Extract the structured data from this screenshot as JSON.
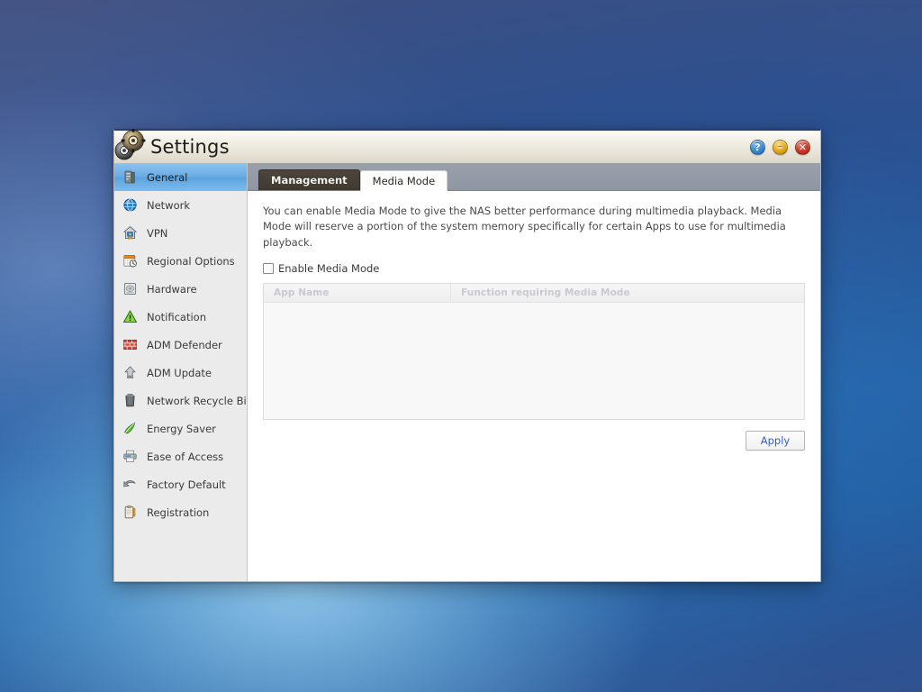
{
  "window": {
    "title": "Settings",
    "app_icon": "gear-icon",
    "buttons": [
      {
        "name": "help-button",
        "icon": "question-mark-icon",
        "glyph": "?",
        "color": "#3e8fd4"
      },
      {
        "name": "minimize-button",
        "icon": "minus-icon",
        "glyph": "–",
        "color": "#e8ad21"
      },
      {
        "name": "close-button",
        "icon": "close-x-icon",
        "glyph": "✕",
        "color": "#d23c2c"
      }
    ]
  },
  "sidebar": {
    "items": [
      {
        "label": "General",
        "icon": "server-icon",
        "selected": true
      },
      {
        "label": "Network",
        "icon": "globe-icon",
        "selected": false
      },
      {
        "label": "VPN",
        "icon": "house-lock-icon",
        "selected": false
      },
      {
        "label": "Regional Options",
        "icon": "calendar-clock-icon",
        "selected": false
      },
      {
        "label": "Hardware",
        "icon": "hard-drive-icon",
        "selected": false
      },
      {
        "label": "Notification",
        "icon": "warning-triangle-icon",
        "selected": false
      },
      {
        "label": "ADM Defender",
        "icon": "firewall-brick-icon",
        "selected": false
      },
      {
        "label": "ADM Update",
        "icon": "up-arrow-icon",
        "selected": false
      },
      {
        "label": "Network Recycle Bin",
        "icon": "trash-bin-icon",
        "selected": false
      },
      {
        "label": "Energy Saver",
        "icon": "green-leaf-icon",
        "selected": false
      },
      {
        "label": "Ease of Access",
        "icon": "printer-icon",
        "selected": false
      },
      {
        "label": "Factory Default",
        "icon": "undo-arrow-icon",
        "selected": false
      },
      {
        "label": "Registration",
        "icon": "clipboard-icon",
        "selected": false
      }
    ]
  },
  "content": {
    "tabs": [
      {
        "label": "Management",
        "active": false
      },
      {
        "label": "Media Mode",
        "active": true
      }
    ],
    "description": "You can enable Media Mode to give the NAS better performance during multimedia playback. Media Mode will reserve a portion of the system memory specifically for certain Apps to use for multimedia playback.",
    "checkbox": {
      "label": "Enable Media Mode",
      "checked": false
    },
    "table": {
      "columns": [
        "App Name",
        "Function requiring Media Mode"
      ],
      "rows": []
    },
    "apply_label": "Apply"
  },
  "colors": {
    "accent_blue": "#3a5fc0",
    "selected_row": "#69abe3",
    "tabbar_gray": "#8f96a3",
    "tab_inactive": "#453f38"
  }
}
